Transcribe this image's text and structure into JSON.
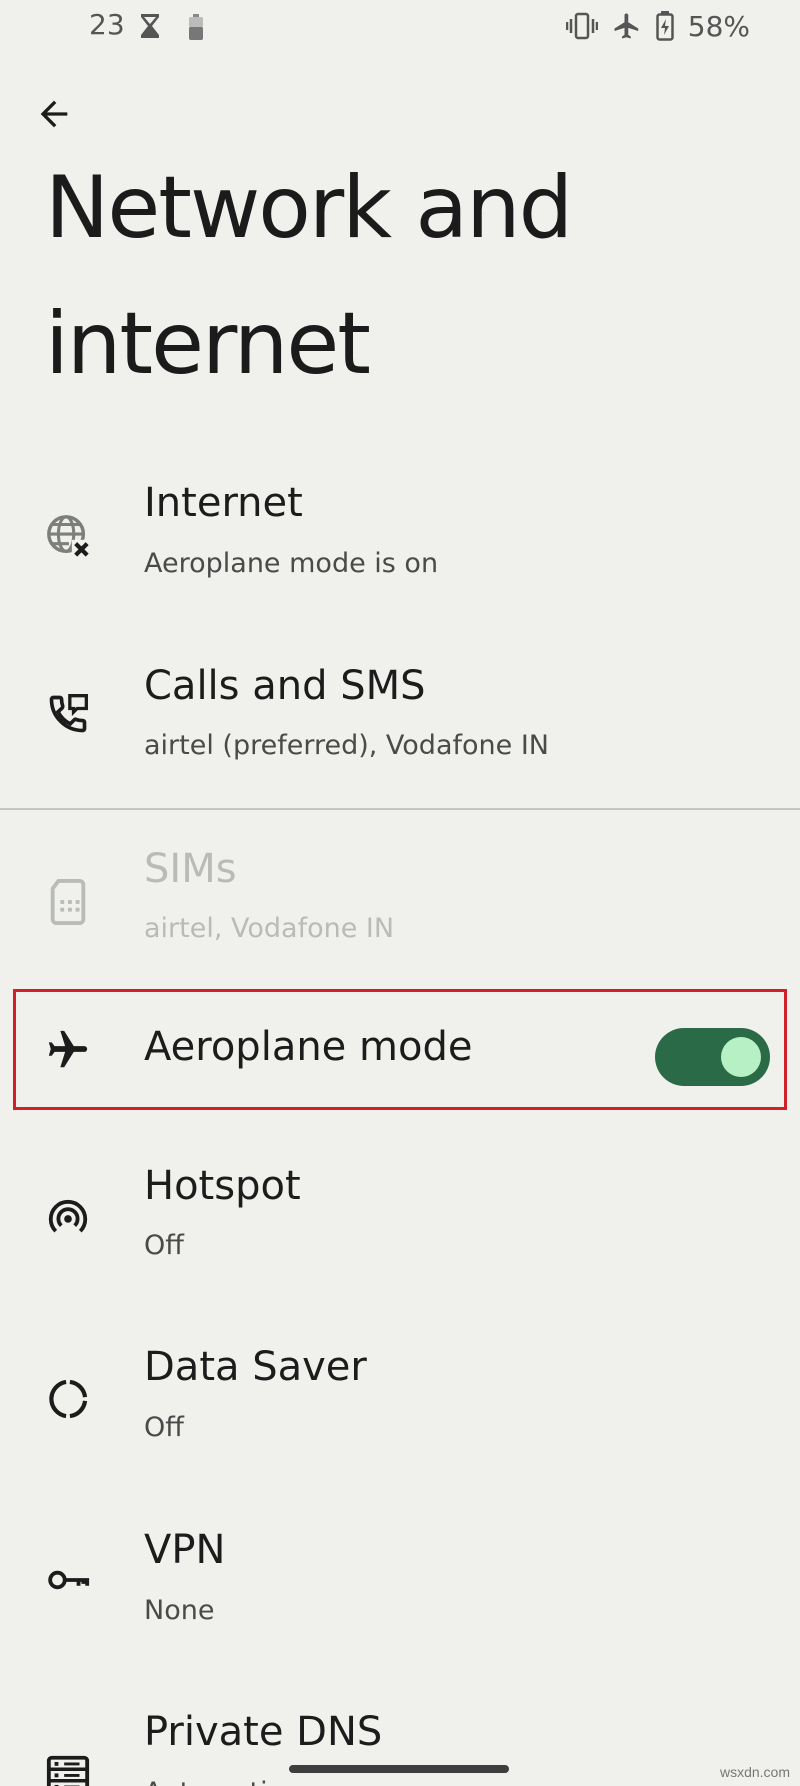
{
  "status_bar": {
    "time": "23",
    "battery_percent": "58%",
    "icons": [
      "hourglass-icon",
      "battery-small-icon",
      "vibrate-icon",
      "airplane-icon",
      "battery-charging-icon"
    ]
  },
  "header": {
    "back_icon": "arrow-back-icon",
    "title": "Network and internet"
  },
  "items": [
    {
      "icon": "globe-off-icon",
      "title": "Internet",
      "subtitle": "Aeroplane mode is on",
      "enabled": true
    },
    {
      "icon": "phone-sms-icon",
      "title": "Calls and SMS",
      "subtitle": "airtel (preferred), Vodafone IN",
      "enabled": true
    },
    {
      "icon": "sim-card-icon",
      "title": "SIMs",
      "subtitle": "airtel, Vodafone IN",
      "enabled": false
    },
    {
      "icon": "airplane-icon",
      "title": "Aeroplane mode",
      "toggle_on": true,
      "highlighted": true
    },
    {
      "icon": "hotspot-icon",
      "title": "Hotspot",
      "subtitle": "Off"
    },
    {
      "icon": "data-saver-icon",
      "title": "Data Saver",
      "subtitle": "Off"
    },
    {
      "icon": "key-icon",
      "title": "VPN",
      "subtitle": "None"
    },
    {
      "icon": "dns-icon",
      "title": "Private DNS",
      "subtitle": "Automatic"
    }
  ],
  "colors": {
    "background": "#f0f1ec",
    "toggle_track": "#2b6a47",
    "toggle_knob": "#b7f0c5",
    "highlight_border": "#d2202a"
  },
  "watermark": "wsxdn.com"
}
